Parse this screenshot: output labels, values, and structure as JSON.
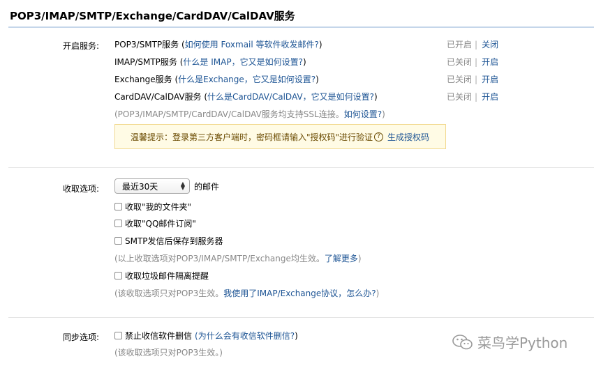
{
  "page": {
    "title": "POP3/IMAP/SMTP/Exchange/CardDAV/CalDAV服务"
  },
  "services": {
    "label": "开启服务:",
    "items": [
      {
        "name": "POP3/SMTP服务 (",
        "link": "如何使用 Foxmail 等软件收发邮件?",
        "tail": " )",
        "state": "已开启",
        "action": "关闭"
      },
      {
        "name": "IMAP/SMTP服务 (",
        "link": "什么是 IMAP，它又是如何设置?",
        "tail": " )",
        "state": "已关闭",
        "action": "开启"
      },
      {
        "name": "Exchange服务 (",
        "link": "什么是Exchange，它又是如何设置?",
        "tail": " )",
        "state": "已关闭",
        "action": "开启"
      },
      {
        "name": "CardDAV/CalDAV服务 (",
        "link": "什么是CardDAV/CalDAV，它又是如何设置?",
        "tail": " )",
        "state": "已关闭",
        "action": "开启"
      }
    ],
    "ssl_note": "(POP3/IMAP/SMTP/CardDAV/CalDAV服务均支持SSL连接。",
    "ssl_link": "如何设置?",
    "ssl_tail": " )",
    "tip_text": "温馨提示：登录第三方客户端时，密码框请输入\"授权码\"进行验证",
    "tip_icon": "?",
    "tip_link": "生成授权码"
  },
  "receive": {
    "label": "收取选项:",
    "select_value": "最近30天",
    "select_suffix": "的邮件",
    "opt1": "收取\"我的文件夹\"",
    "opt2": "收取\"QQ邮件订阅\"",
    "opt3": "SMTP发信后保存到服务器",
    "note1": "(以上收取选项对POP3/IMAP/SMTP/Exchange均生效。",
    "note1_link": "了解更多",
    "note1_tail": ")",
    "opt4": "收取垃圾邮件隔离提醒",
    "note2": "(该收取选项只对POP3生效。",
    "note2_link": "我使用了IMAP/Exchange协议，怎么办?",
    "note2_tail": " )"
  },
  "sync": {
    "label": "同步选项:",
    "opt1": "禁止收信软件删信",
    "opt1_link": "(为什么会有收信软件删信?",
    "opt1_tail": " )",
    "note": "(该收取选项只对POP3生效。)"
  },
  "watermark": {
    "text": "菜鸟学Python",
    "icon": "wechat-icon"
  }
}
